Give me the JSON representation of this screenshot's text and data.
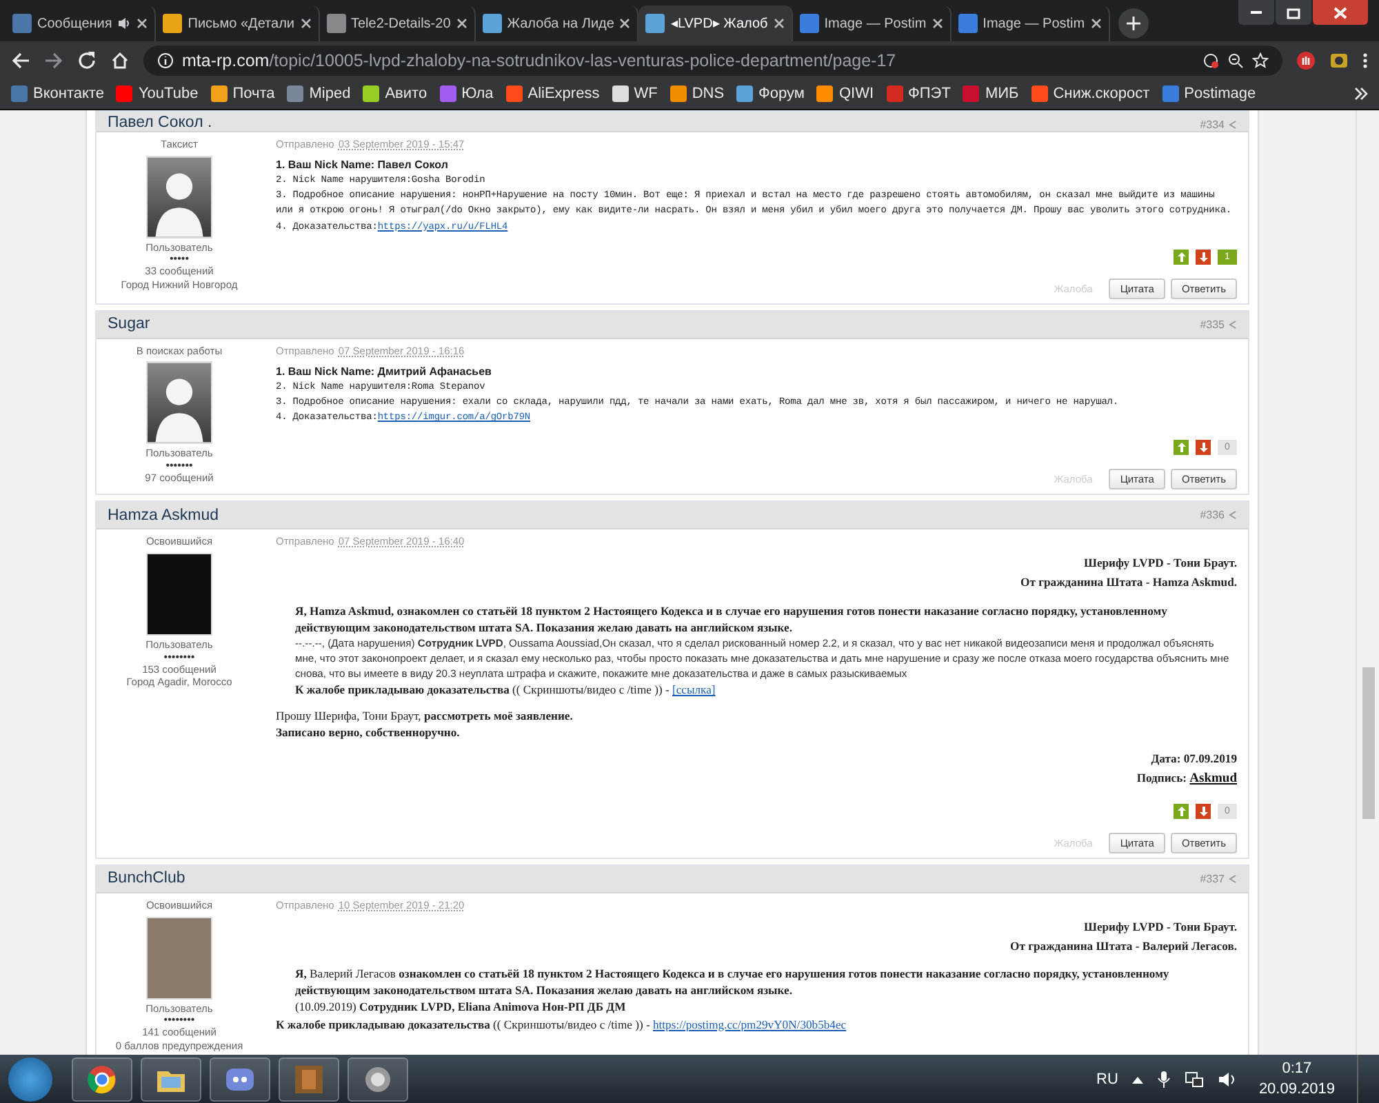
{
  "browser": {
    "tabs": [
      {
        "title": "Сообщения",
        "kind": "vk",
        "audio": true,
        "selected": false
      },
      {
        "title": "Письмо «Детали",
        "kind": "mail",
        "audio": false,
        "selected": false
      },
      {
        "title": "Tele2-Details-20",
        "kind": "globe",
        "audio": false,
        "selected": false
      },
      {
        "title": "Жалоба на Лиде",
        "kind": "forum",
        "audio": false,
        "selected": false
      },
      {
        "title": "◂LVPD▸ Жалоб",
        "kind": "forum",
        "audio": false,
        "selected": true
      },
      {
        "title": "Image — Postim",
        "kind": "postimage",
        "audio": false,
        "selected": false
      },
      {
        "title": "Image — Postim",
        "kind": "postimage",
        "audio": false,
        "selected": false
      }
    ],
    "url_host": "mta-rp.com",
    "url_path": "/topic/10005-lvpd-zhaloby-na-sotrudnikov-las-venturas-police-department/page-17",
    "bookmarks": [
      {
        "label": "Вконтакте",
        "color": "#4a76a8"
      },
      {
        "label": "YouTube",
        "color": "#ff0000"
      },
      {
        "label": "Почта",
        "color": "#f2a31b"
      },
      {
        "label": "Miped",
        "color": "#7a8799"
      },
      {
        "label": "Авито",
        "color": "#97cf26"
      },
      {
        "label": "Юла",
        "color": "#a35cf0"
      },
      {
        "label": "AliExpress",
        "color": "#ff4a1c"
      },
      {
        "label": "WF",
        "color": "#dddddd"
      },
      {
        "label": "DNS",
        "color": "#f08c00"
      },
      {
        "label": "Форум",
        "color": "#5ba3d9"
      },
      {
        "label": "QIWI",
        "color": "#ff8c00"
      },
      {
        "label": "ФПЭТ",
        "color": "#d52b1e"
      },
      {
        "label": "МИБ",
        "color": "#c8102e"
      },
      {
        "label": "Сниж.скорост",
        "color": "#ff4a1c"
      },
      {
        "label": "Postimage",
        "color": "#3b7ddd"
      }
    ]
  },
  "posts": [
    {
      "author": "Павел Сокол .",
      "number": "#334",
      "user_title": "Таксист",
      "avatar": {
        "kind": "default"
      },
      "group": "Пользователь",
      "pips": "•••••",
      "posts_count": "33 сообщений",
      "extra": "Город Нижний Новгород",
      "posted_label": "Отправлено",
      "date": "03 September 2019 - 15:47",
      "body": [
        {
          "kind": "bold",
          "text": "1. Ваш Nick Name: Павел Сокол"
        },
        {
          "kind": "mono",
          "text": "2. Nick Name нарушителя:Gosha Borodin"
        },
        {
          "kind": "mono",
          "text": "3. Подробное описание нарушения: нонРП+Нарушение на посту 10мин. Вот еще: Я приехал и встал на место где разрешено стоять автомобилям, он сказал мне выйдите из машины или я открою огонь! Я отыграл(/do Окно закрыто), ему как видите-ли насрать. Он взял и меня убил и убил моего друга это получается ДМ. Прошу вас уволить этого сотрудника."
        },
        {
          "kind": "mono",
          "text": "4. Доказательства:",
          "link": "https://yapx.ru/u/FLHL4"
        }
      ],
      "rep": {
        "count": "1",
        "positive": true
      },
      "actions": {
        "report": "Жалоба",
        "quote": "Цитата",
        "reply": "Ответить"
      }
    },
    {
      "author": "Sugar",
      "number": "#335",
      "user_title": "В поисках работы",
      "avatar": {
        "kind": "default"
      },
      "group": "Пользователь",
      "pips": "•••••••",
      "posts_count": "97 сообщений",
      "posted_label": "Отправлено",
      "date": "07 September 2019 - 16:16",
      "body": [
        {
          "kind": "bold",
          "text": "1. Ваш Nick Name: Дмитрий Афанасьев"
        },
        {
          "kind": "mono",
          "text": "2. Nick Name нарушителя:Roma Stepanov"
        },
        {
          "kind": "mono",
          "text": "3. Подробное описание нарушения: ехали со склада, нарушили пдд, те начали за нами ехать, Roma дал мне зв, хотя я был пассажиром, и ничего не нарушал."
        },
        {
          "kind": "mono",
          "text": "4. Доказательства:",
          "link": "https://imgur.com/a/gOrb79N"
        }
      ],
      "rep": {
        "count": "0",
        "positive": false
      },
      "actions": {
        "report": "Жалоба",
        "quote": "Цитата",
        "reply": "Ответить"
      }
    },
    {
      "author": "Hamza Askmud",
      "number": "#336",
      "user_title": "Освоившийся",
      "avatar": {
        "kind": "dark-photo"
      },
      "group": "Пользователь",
      "pips": "••••••••",
      "posts_count": "153 сообщений",
      "extra": "Город Agadir, Morocco",
      "posted_label": "Отправлено",
      "date": "07 September 2019 - 16:40",
      "body": [
        {
          "kind": "right",
          "text": "Шерифу LVPD - Тони Браут."
        },
        {
          "kind": "right",
          "text": "От гражданина Штата - Hamza Askmud."
        },
        {
          "kind": "serif",
          "gap_before": true,
          "indent": true,
          "text": "**Я, Hamza Askmud, ознакомлен со статьёй 18 пунктом 2 Настоящего Кодекса и в случае его нарушения готов понести наказание согласно порядку, установленному действующим законодательством штата SA. Показания желаю давать на английском языке.**"
        },
        {
          "kind": "sans",
          "indent": true,
          "text": "--.--.--, (Дата нарушения) **Сотрудник LVPD**, Oussama Aoussiad,Он сказал, что я сделал рискованный номер 2.2, и я сказал, что у вас нет никакой видеозаписи меня и продолжал объяснять мне, что этот законопроект делает, и я сказал ему несколько раз, чтобы просто показать мне доказательства и дать мне нарушение и сразу же после отказа моего государства объяснить мне снова, что вы имеете в виду 20.3 неуплата штрафа и скажите, покажите мне доказательства и даже в самых разыскиваемых"
        },
        {
          "kind": "serif",
          "indent": true,
          "text": "**К жалобе прикладываю доказательства** (( Скриншоты/видео с /time )) - ",
          "link": "[ссылка]"
        },
        {
          "kind": "serif",
          "gap_before": true,
          "text": " Прошу Шерифа, Тони Браут, **рассмотреть моё заявление.**"
        },
        {
          "kind": "serif",
          "text": "**Записано верно, собственноручно.**"
        },
        {
          "kind": "right",
          "gap_before": true,
          "text": "Дата: 07.09.2019"
        },
        {
          "kind": "right",
          "text": "Подпись: ",
          "link": "Askmud"
        }
      ],
      "rep": {
        "count": "0",
        "positive": false
      },
      "actions": {
        "report": "Жалоба",
        "quote": "Цитата",
        "reply": "Ответить"
      }
    },
    {
      "author": "BunchClub",
      "number": "#337",
      "user_title": "Освоившийся",
      "avatar": {
        "kind": "photo"
      },
      "group": "Пользователь",
      "pips": "••••••••",
      "posts_count": "141 сообщений",
      "extra": "0 баллов предупреждения",
      "posted_label": "Отправлено",
      "date": "10 September 2019 - 21:20",
      "body": [
        {
          "kind": "right",
          "text": "Шерифу LVPD - Тони Браут."
        },
        {
          "kind": "right",
          "text": "От гражданина Штата - Валерий Легасов."
        },
        {
          "kind": "serif",
          "gap_before": true,
          "indent": true,
          "text": "**Я,** Валерий Легасов **ознакомлен со статьёй 18 пунктом 2 Настоящего Кодекса и в случае его нарушения готов понести наказание согласно порядку, установленному действующим законодательством штата SA. Показания желаю давать на английском языке.**"
        },
        {
          "kind": "serif",
          "indent": true,
          "text": "      (10.09.2019) **Сотрудник LVPD, Eliana Animova  Нон-РП ДБ ДМ**"
        },
        {
          "kind": "serif",
          "text": "**К жалобе прикладываю доказательства** (( Скриншоты/видео с /time )) - ",
          "link": "https://postimg.cc/pm29vY0N/30b5b4ec"
        }
      ]
    }
  ],
  "taskbar": {
    "language": "RU",
    "time": "0:17",
    "date": "20.09.2019"
  }
}
